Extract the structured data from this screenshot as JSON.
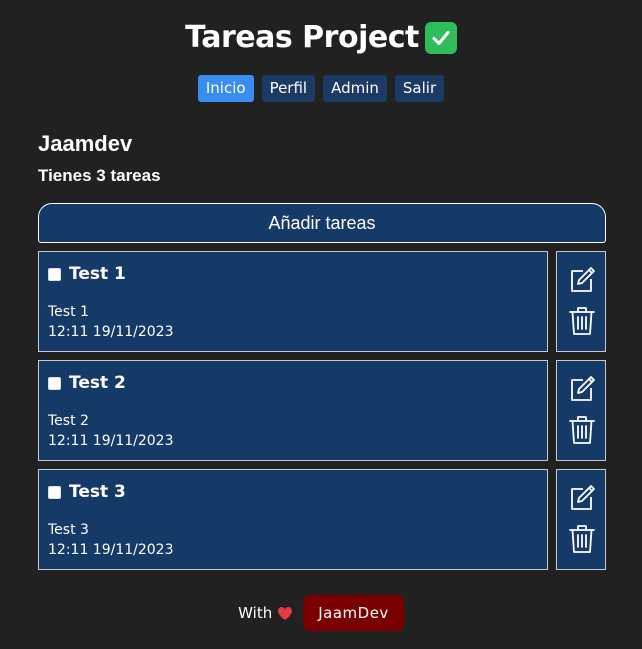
{
  "header": {
    "title": "Tareas Project",
    "title_icon": "check-mark-button-icon"
  },
  "nav": {
    "items": [
      {
        "label": "Inicio"
      },
      {
        "label": "Perfil"
      },
      {
        "label": "Admin"
      },
      {
        "label": "Salir"
      }
    ],
    "active": "Inicio"
  },
  "user": {
    "name": "Jaamdev",
    "task_count_text": "Tienes 3 tareas"
  },
  "add_button": {
    "label": "Añadir tareas"
  },
  "tasks": [
    {
      "title": "Test 1",
      "description": "Test 1",
      "datetime": "12:11 19/11/2023",
      "checked": false
    },
    {
      "title": "Test 2",
      "description": "Test 2",
      "datetime": "12:11 19/11/2023",
      "checked": false
    },
    {
      "title": "Test 3",
      "description": "Test 3",
      "datetime": "12:11 19/11/2023",
      "checked": false
    }
  ],
  "footer": {
    "with_text": "With",
    "heart_icon": "heart-icon",
    "author_label": "JaamDev"
  },
  "colors": {
    "background": "#212121",
    "card": "#163a68",
    "nav_button": "#1b3a64",
    "nav_active": "#3b8cf0",
    "author_button": "#7a0000",
    "check_green": "#2fbd5b",
    "heart": "#e53946"
  }
}
